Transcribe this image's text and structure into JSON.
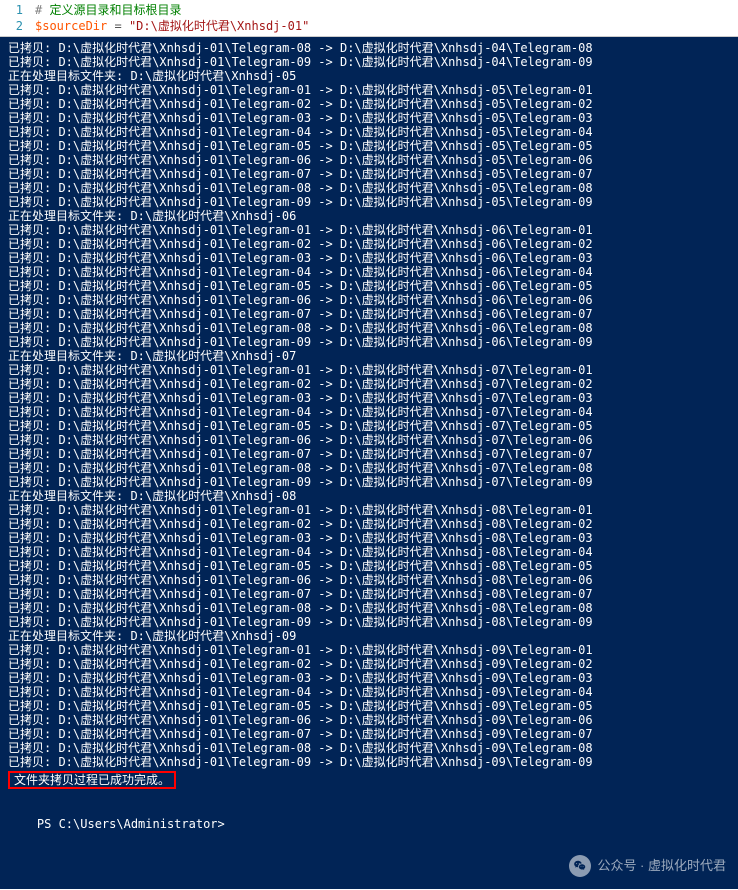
{
  "editor": {
    "line1_num": "1",
    "line2_num": "2",
    "line1_hash": "# ",
    "line1_comment": "定义源目录和目标根目录",
    "line2_var": "$sourceDir ",
    "line2_eq": "= ",
    "line2_str": "\"D:\\虚拟化时代君\\Xnhsdj-01\""
  },
  "terminal": {
    "lines_group1": [
      "已拷贝: D:\\虚拟化时代君\\Xnhsdj-01\\Telegram-08 -> D:\\虚拟化时代君\\Xnhsdj-04\\Telegram-08",
      "已拷贝: D:\\虚拟化时代君\\Xnhsdj-01\\Telegram-09 -> D:\\虚拟化时代君\\Xnhsdj-04\\Telegram-09",
      "正在处理目标文件夹: D:\\虚拟化时代君\\Xnhsdj-05"
    ],
    "lines_group2": [
      "已拷贝: D:\\虚拟化时代君\\Xnhsdj-01\\Telegram-01 -> D:\\虚拟化时代君\\Xnhsdj-05\\Telegram-01",
      "已拷贝: D:\\虚拟化时代君\\Xnhsdj-01\\Telegram-02 -> D:\\虚拟化时代君\\Xnhsdj-05\\Telegram-02",
      "已拷贝: D:\\虚拟化时代君\\Xnhsdj-01\\Telegram-03 -> D:\\虚拟化时代君\\Xnhsdj-05\\Telegram-03",
      "已拷贝: D:\\虚拟化时代君\\Xnhsdj-01\\Telegram-04 -> D:\\虚拟化时代君\\Xnhsdj-05\\Telegram-04",
      "已拷贝: D:\\虚拟化时代君\\Xnhsdj-01\\Telegram-05 -> D:\\虚拟化时代君\\Xnhsdj-05\\Telegram-05",
      "已拷贝: D:\\虚拟化时代君\\Xnhsdj-01\\Telegram-06 -> D:\\虚拟化时代君\\Xnhsdj-05\\Telegram-06",
      "已拷贝: D:\\虚拟化时代君\\Xnhsdj-01\\Telegram-07 -> D:\\虚拟化时代君\\Xnhsdj-05\\Telegram-07",
      "已拷贝: D:\\虚拟化时代君\\Xnhsdj-01\\Telegram-08 -> D:\\虚拟化时代君\\Xnhsdj-05\\Telegram-08",
      "已拷贝: D:\\虚拟化时代君\\Xnhsdj-01\\Telegram-09 -> D:\\虚拟化时代君\\Xnhsdj-05\\Telegram-09",
      "正在处理目标文件夹: D:\\虚拟化时代君\\Xnhsdj-06"
    ],
    "lines_group3": [
      "已拷贝: D:\\虚拟化时代君\\Xnhsdj-01\\Telegram-01 -> D:\\虚拟化时代君\\Xnhsdj-06\\Telegram-01",
      "已拷贝: D:\\虚拟化时代君\\Xnhsdj-01\\Telegram-02 -> D:\\虚拟化时代君\\Xnhsdj-06\\Telegram-02",
      "已拷贝: D:\\虚拟化时代君\\Xnhsdj-01\\Telegram-03 -> D:\\虚拟化时代君\\Xnhsdj-06\\Telegram-03",
      "已拷贝: D:\\虚拟化时代君\\Xnhsdj-01\\Telegram-04 -> D:\\虚拟化时代君\\Xnhsdj-06\\Telegram-04",
      "已拷贝: D:\\虚拟化时代君\\Xnhsdj-01\\Telegram-05 -> D:\\虚拟化时代君\\Xnhsdj-06\\Telegram-05",
      "已拷贝: D:\\虚拟化时代君\\Xnhsdj-01\\Telegram-06 -> D:\\虚拟化时代君\\Xnhsdj-06\\Telegram-06",
      "已拷贝: D:\\虚拟化时代君\\Xnhsdj-01\\Telegram-07 -> D:\\虚拟化时代君\\Xnhsdj-06\\Telegram-07",
      "已拷贝: D:\\虚拟化时代君\\Xnhsdj-01\\Telegram-08 -> D:\\虚拟化时代君\\Xnhsdj-06\\Telegram-08",
      "已拷贝: D:\\虚拟化时代君\\Xnhsdj-01\\Telegram-09 -> D:\\虚拟化时代君\\Xnhsdj-06\\Telegram-09",
      "正在处理目标文件夹: D:\\虚拟化时代君\\Xnhsdj-07"
    ],
    "lines_group4": [
      "已拷贝: D:\\虚拟化时代君\\Xnhsdj-01\\Telegram-01 -> D:\\虚拟化时代君\\Xnhsdj-07\\Telegram-01",
      "已拷贝: D:\\虚拟化时代君\\Xnhsdj-01\\Telegram-02 -> D:\\虚拟化时代君\\Xnhsdj-07\\Telegram-02",
      "已拷贝: D:\\虚拟化时代君\\Xnhsdj-01\\Telegram-03 -> D:\\虚拟化时代君\\Xnhsdj-07\\Telegram-03",
      "已拷贝: D:\\虚拟化时代君\\Xnhsdj-01\\Telegram-04 -> D:\\虚拟化时代君\\Xnhsdj-07\\Telegram-04",
      "已拷贝: D:\\虚拟化时代君\\Xnhsdj-01\\Telegram-05 -> D:\\虚拟化时代君\\Xnhsdj-07\\Telegram-05",
      "已拷贝: D:\\虚拟化时代君\\Xnhsdj-01\\Telegram-06 -> D:\\虚拟化时代君\\Xnhsdj-07\\Telegram-06",
      "已拷贝: D:\\虚拟化时代君\\Xnhsdj-01\\Telegram-07 -> D:\\虚拟化时代君\\Xnhsdj-07\\Telegram-07",
      "已拷贝: D:\\虚拟化时代君\\Xnhsdj-01\\Telegram-08 -> D:\\虚拟化时代君\\Xnhsdj-07\\Telegram-08",
      "已拷贝: D:\\虚拟化时代君\\Xnhsdj-01\\Telegram-09 -> D:\\虚拟化时代君\\Xnhsdj-07\\Telegram-09",
      "正在处理目标文件夹: D:\\虚拟化时代君\\Xnhsdj-08"
    ],
    "lines_group5": [
      "已拷贝: D:\\虚拟化时代君\\Xnhsdj-01\\Telegram-01 -> D:\\虚拟化时代君\\Xnhsdj-08\\Telegram-01",
      "已拷贝: D:\\虚拟化时代君\\Xnhsdj-01\\Telegram-02 -> D:\\虚拟化时代君\\Xnhsdj-08\\Telegram-02",
      "已拷贝: D:\\虚拟化时代君\\Xnhsdj-01\\Telegram-03 -> D:\\虚拟化时代君\\Xnhsdj-08\\Telegram-03",
      "已拷贝: D:\\虚拟化时代君\\Xnhsdj-01\\Telegram-04 -> D:\\虚拟化时代君\\Xnhsdj-08\\Telegram-04",
      "已拷贝: D:\\虚拟化时代君\\Xnhsdj-01\\Telegram-05 -> D:\\虚拟化时代君\\Xnhsdj-08\\Telegram-05",
      "已拷贝: D:\\虚拟化时代君\\Xnhsdj-01\\Telegram-06 -> D:\\虚拟化时代君\\Xnhsdj-08\\Telegram-06",
      "已拷贝: D:\\虚拟化时代君\\Xnhsdj-01\\Telegram-07 -> D:\\虚拟化时代君\\Xnhsdj-08\\Telegram-07",
      "已拷贝: D:\\虚拟化时代君\\Xnhsdj-01\\Telegram-08 -> D:\\虚拟化时代君\\Xnhsdj-08\\Telegram-08",
      "已拷贝: D:\\虚拟化时代君\\Xnhsdj-01\\Telegram-09 -> D:\\虚拟化时代君\\Xnhsdj-08\\Telegram-09",
      "正在处理目标文件夹: D:\\虚拟化时代君\\Xnhsdj-09"
    ],
    "lines_group6": [
      "已拷贝: D:\\虚拟化时代君\\Xnhsdj-01\\Telegram-01 -> D:\\虚拟化时代君\\Xnhsdj-09\\Telegram-01",
      "已拷贝: D:\\虚拟化时代君\\Xnhsdj-01\\Telegram-02 -> D:\\虚拟化时代君\\Xnhsdj-09\\Telegram-02",
      "已拷贝: D:\\虚拟化时代君\\Xnhsdj-01\\Telegram-03 -> D:\\虚拟化时代君\\Xnhsdj-09\\Telegram-03",
      "已拷贝: D:\\虚拟化时代君\\Xnhsdj-01\\Telegram-04 -> D:\\虚拟化时代君\\Xnhsdj-09\\Telegram-04",
      "已拷贝: D:\\虚拟化时代君\\Xnhsdj-01\\Telegram-05 -> D:\\虚拟化时代君\\Xnhsdj-09\\Telegram-05",
      "已拷贝: D:\\虚拟化时代君\\Xnhsdj-01\\Telegram-06 -> D:\\虚拟化时代君\\Xnhsdj-09\\Telegram-06",
      "已拷贝: D:\\虚拟化时代君\\Xnhsdj-01\\Telegram-07 -> D:\\虚拟化时代君\\Xnhsdj-09\\Telegram-07",
      "已拷贝: D:\\虚拟化时代君\\Xnhsdj-01\\Telegram-08 -> D:\\虚拟化时代君\\Xnhsdj-09\\Telegram-08",
      "已拷贝: D:\\虚拟化时代君\\Xnhsdj-01\\Telegram-09 -> D:\\虚拟化时代君\\Xnhsdj-09\\Telegram-09"
    ],
    "completion_msg": "文件夹拷贝过程已成功完成。",
    "prompt": "PS C:\\Users\\Administrator> ",
    "watermark": "公众号 · 虚拟化时代君"
  }
}
